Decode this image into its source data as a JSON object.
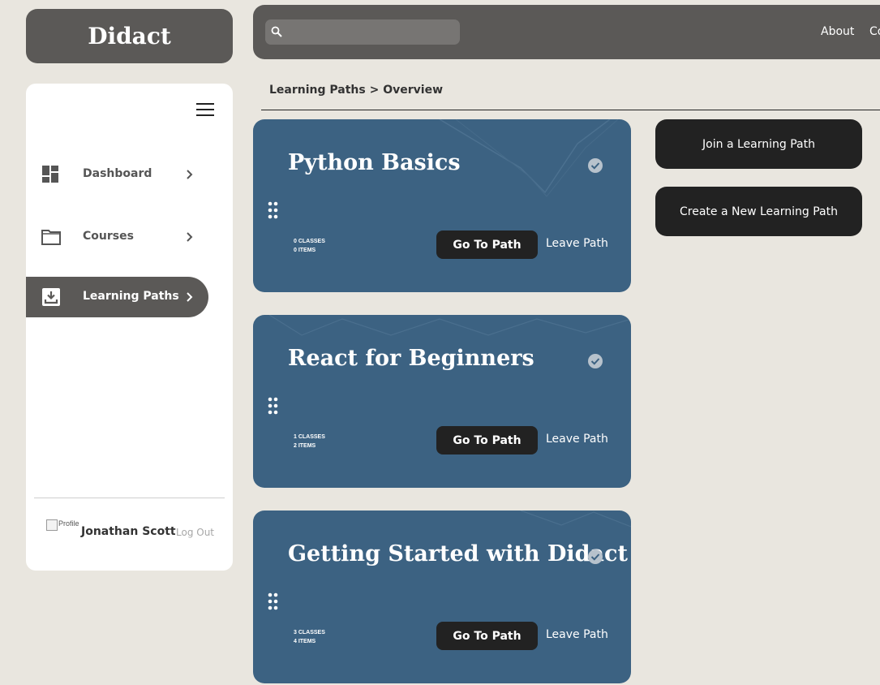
{
  "brand": {
    "name": "Didact"
  },
  "topbar": {
    "search_placeholder": "",
    "nav": [
      "About",
      "Co"
    ]
  },
  "sidebar": {
    "items": [
      {
        "label": "Dashboard",
        "icon": "dashboard-icon"
      },
      {
        "label": "Courses",
        "icon": "folder-icon"
      },
      {
        "label": "Learning Paths",
        "icon": "learning-paths-icon"
      }
    ],
    "active": "Learning Paths",
    "user": {
      "avatar_alt": "Profile",
      "name": "Jonathan Scott",
      "logout": "Log Out"
    }
  },
  "breadcrumb": {
    "parent": "Learning Paths",
    "separator": ">",
    "current": "Overview"
  },
  "cards": [
    {
      "title": "Python Basics",
      "classes": "0 CLASSES",
      "items": "0 ITEMS",
      "go_label": "Go To Path",
      "leave_label": "Leave Path"
    },
    {
      "title": "React for Beginners",
      "classes": "1 CLASSES",
      "items": "2 ITEMS",
      "go_label": "Go To Path",
      "leave_label": "Leave Path"
    },
    {
      "title": "Getting Started with Didact",
      "classes": "3 CLASSES",
      "items": "4 ITEMS",
      "go_label": "Go To Path",
      "leave_label": "Leave Path"
    }
  ],
  "actions": {
    "join": "Join a Learning Path",
    "create": "Create a New Learning Path"
  },
  "colors": {
    "background": "#e9e6df",
    "dark_gray": "#5b5957",
    "card_blue": "#3c6282",
    "button_dark": "#222222"
  }
}
